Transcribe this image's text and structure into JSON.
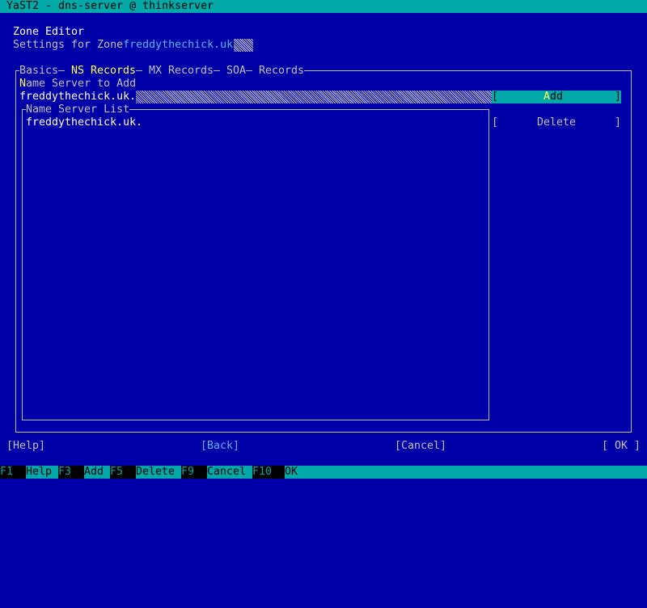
{
  "window": {
    "title": "YaST2 - dns-server @ thinkserver"
  },
  "dialog": {
    "title": "Zone Editor",
    "subtitle_prefix": "Settings for Zone",
    "zone_name": "freddythechick.uk"
  },
  "tabs": [
    {
      "label": "Basics",
      "active": false
    },
    {
      "label": "NS Records",
      "active": true
    },
    {
      "label": "MX Records",
      "active": false
    },
    {
      "label": "SOA",
      "active": false
    },
    {
      "label": "Records",
      "active": false
    }
  ],
  "ns": {
    "input_label_hot": "N",
    "input_label_rest": "ame Server to Add",
    "input_value": "freddythechick.uk.",
    "add_button_hot": "A",
    "add_button_rest": "dd",
    "list_label": "Name Server List",
    "list_items": [
      "freddythechick.uk."
    ],
    "delete_button": "Delete"
  },
  "footer": {
    "help": "[Help]",
    "back": "[Back]",
    "cancel": "[Cancel]",
    "ok": "[ OK ]"
  },
  "fkeys": [
    {
      "key": "F1",
      "label": "Help"
    },
    {
      "key": "F3",
      "label": "Add"
    },
    {
      "key": "F5",
      "label": "Delete"
    },
    {
      "key": "F9",
      "label": "Cancel"
    },
    {
      "key": "F10",
      "label": "OK"
    }
  ],
  "colors": {
    "background": "#0000a8",
    "accent": "#00a8a8",
    "highlight": "#ffff55",
    "text": "#c0c0c0"
  }
}
